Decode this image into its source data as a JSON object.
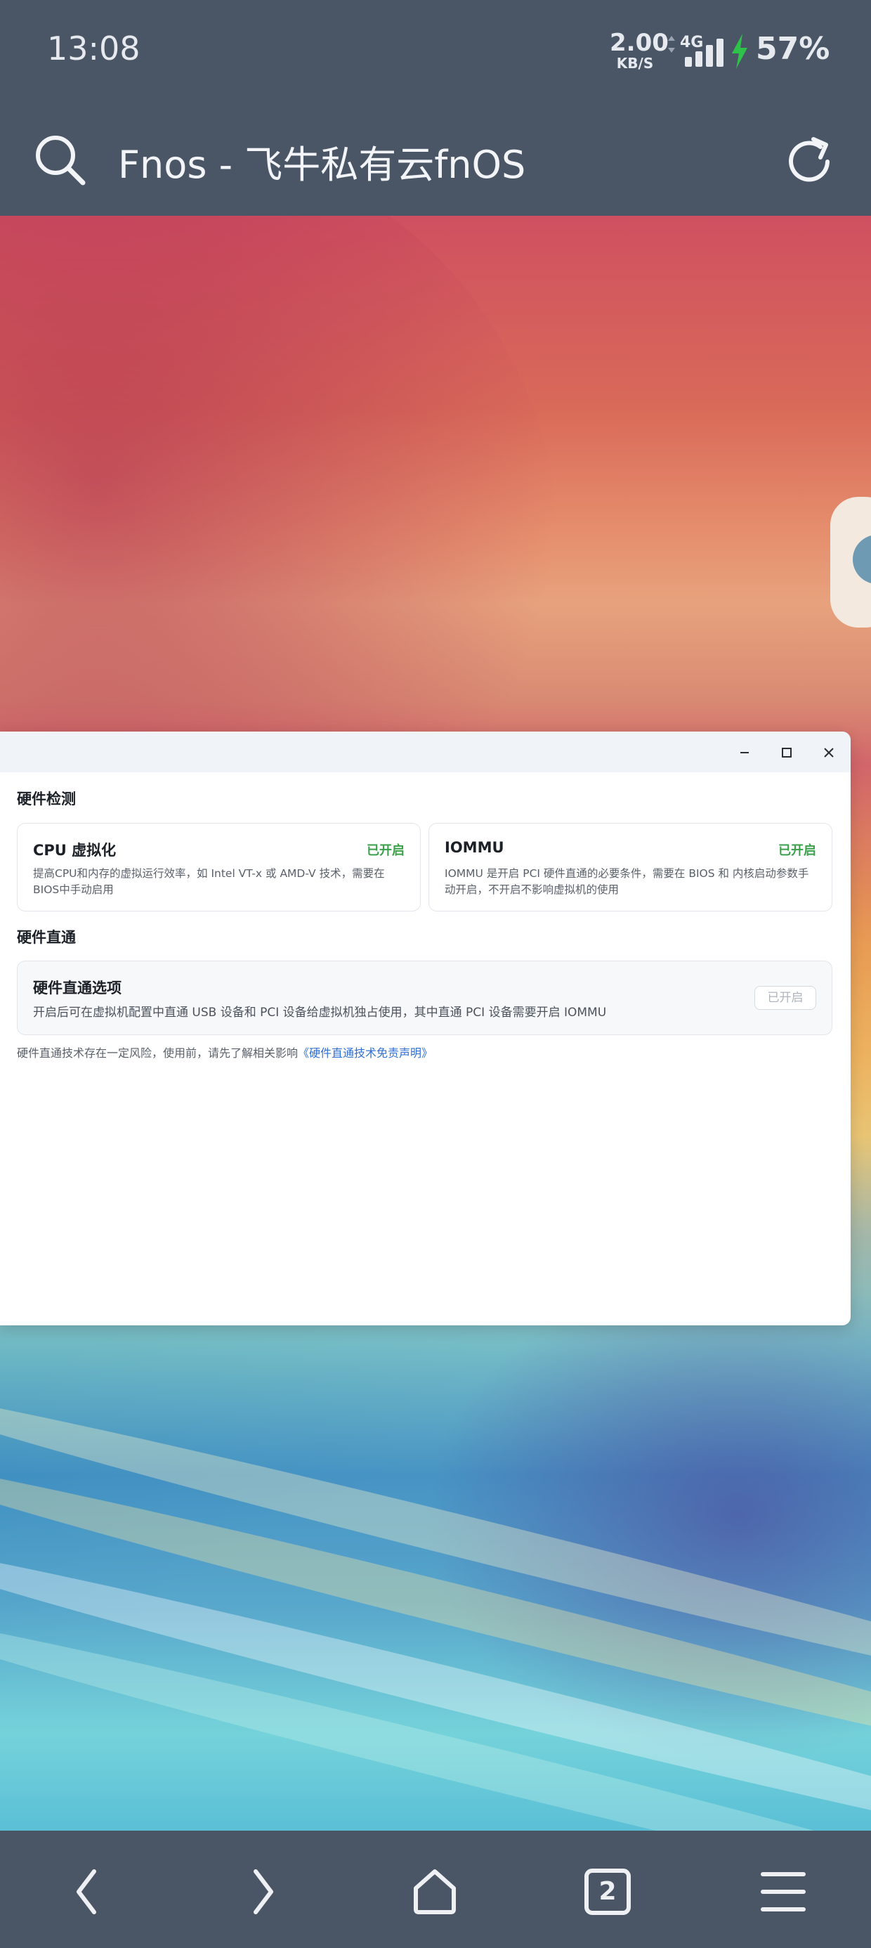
{
  "status_bar": {
    "time": "13:08",
    "net_speed": "2.00",
    "net_unit": "KB/S",
    "network_type": "4G",
    "battery": "57%",
    "charging_color": "#2ec24a"
  },
  "browser": {
    "page_title": "Fnos - 飞牛私有云fnOS",
    "tab_count": "2"
  },
  "window": {
    "hardware_check_title": "硬件检测",
    "cards": [
      {
        "title": "CPU 虚拟化",
        "status": "已开启",
        "desc": "提高CPU和内存的虚拟运行效率，如 Intel VT-x 或 AMD-V 技术，需要在BIOS中手动启用"
      },
      {
        "title": "IOMMU",
        "status": "已开启",
        "desc": "IOMMU 是开启 PCI 硬件直通的必要条件，需要在 BIOS 和 内核启动参数手动开启，不开启不影响虚拟机的使用"
      }
    ],
    "passthrough_title": "硬件直通",
    "passthrough": {
      "title": "硬件直通选项",
      "desc": "开启后可在虚拟机配置中直通 USB 设备和 PCI 设备给虚拟机独占使用，其中直通 PCI 设备需要开启 IOMMU",
      "button": "已开启"
    },
    "disclaimer_text": "硬件直通技术存在一定风险，使用前，请先了解相关影响",
    "disclaimer_link": "《硬件直通技术免责声明》"
  },
  "icons": {
    "search": "search-icon",
    "reload": "reload-icon",
    "minimize": "minimize-icon",
    "maximize": "maximize-icon",
    "close": "close-icon",
    "back": "chevron-left-icon",
    "forward": "chevron-right-icon",
    "home": "home-icon",
    "tabs": "tabs-icon",
    "menu": "menu-icon"
  },
  "colors": {
    "chrome": "#4a5566",
    "enabled_status": "#3aa14a",
    "link": "#2f6fd6"
  }
}
